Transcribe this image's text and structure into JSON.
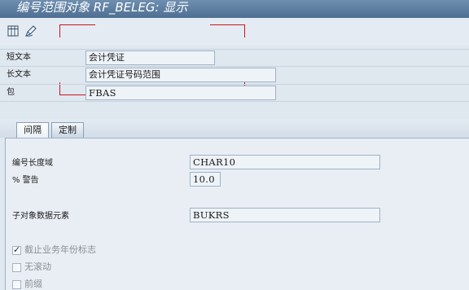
{
  "window": {
    "title": "编号范围对象 RF_BELEG: 显示"
  },
  "toolbar": {
    "icons": [
      "table-icon",
      "edit-pen-icon"
    ]
  },
  "header_fields": [
    {
      "label": "短文本",
      "value": "会计凭证"
    },
    {
      "label": "长文本",
      "value": "会计凭证号码范围"
    },
    {
      "label": "包",
      "value": "FBAS"
    }
  ],
  "tabs": [
    {
      "label": "间隔",
      "active": true
    },
    {
      "label": "定制",
      "active": false
    }
  ],
  "interval": {
    "length_domain_label": "编号长度域",
    "length_domain_value": "CHAR10",
    "warning_label": "% 警告",
    "warning_value": "10.0",
    "subobject_label": "子对象数据元素",
    "subobject_value": "BUKRS"
  },
  "checkboxes": [
    {
      "label": "截止业务年份标志",
      "checked": true
    },
    {
      "label": "无滚动",
      "checked": false
    },
    {
      "label": "前缀",
      "checked": false
    }
  ],
  "colors": {
    "title_bar": "#5a7a9c",
    "annotation": "#c8161d",
    "background": "#dfe7ef"
  }
}
